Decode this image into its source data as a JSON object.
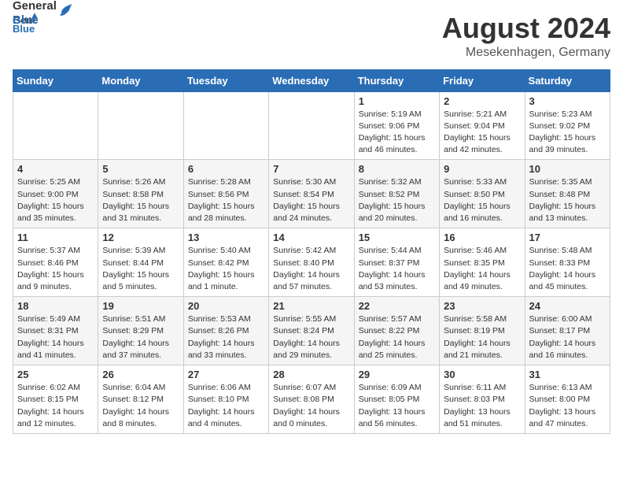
{
  "header": {
    "logo_general": "General",
    "logo_blue": "Blue",
    "month_year": "August 2024",
    "location": "Mesekenhagen, Germany"
  },
  "weekdays": [
    "Sunday",
    "Monday",
    "Tuesday",
    "Wednesday",
    "Thursday",
    "Friday",
    "Saturday"
  ],
  "weeks": [
    [
      {
        "day": "",
        "info": ""
      },
      {
        "day": "",
        "info": ""
      },
      {
        "day": "",
        "info": ""
      },
      {
        "day": "",
        "info": ""
      },
      {
        "day": "1",
        "info": "Sunrise: 5:19 AM\nSunset: 9:06 PM\nDaylight: 15 hours\nand 46 minutes."
      },
      {
        "day": "2",
        "info": "Sunrise: 5:21 AM\nSunset: 9:04 PM\nDaylight: 15 hours\nand 42 minutes."
      },
      {
        "day": "3",
        "info": "Sunrise: 5:23 AM\nSunset: 9:02 PM\nDaylight: 15 hours\nand 39 minutes."
      }
    ],
    [
      {
        "day": "4",
        "info": "Sunrise: 5:25 AM\nSunset: 9:00 PM\nDaylight: 15 hours\nand 35 minutes."
      },
      {
        "day": "5",
        "info": "Sunrise: 5:26 AM\nSunset: 8:58 PM\nDaylight: 15 hours\nand 31 minutes."
      },
      {
        "day": "6",
        "info": "Sunrise: 5:28 AM\nSunset: 8:56 PM\nDaylight: 15 hours\nand 28 minutes."
      },
      {
        "day": "7",
        "info": "Sunrise: 5:30 AM\nSunset: 8:54 PM\nDaylight: 15 hours\nand 24 minutes."
      },
      {
        "day": "8",
        "info": "Sunrise: 5:32 AM\nSunset: 8:52 PM\nDaylight: 15 hours\nand 20 minutes."
      },
      {
        "day": "9",
        "info": "Sunrise: 5:33 AM\nSunset: 8:50 PM\nDaylight: 15 hours\nand 16 minutes."
      },
      {
        "day": "10",
        "info": "Sunrise: 5:35 AM\nSunset: 8:48 PM\nDaylight: 15 hours\nand 13 minutes."
      }
    ],
    [
      {
        "day": "11",
        "info": "Sunrise: 5:37 AM\nSunset: 8:46 PM\nDaylight: 15 hours\nand 9 minutes."
      },
      {
        "day": "12",
        "info": "Sunrise: 5:39 AM\nSunset: 8:44 PM\nDaylight: 15 hours\nand 5 minutes."
      },
      {
        "day": "13",
        "info": "Sunrise: 5:40 AM\nSunset: 8:42 PM\nDaylight: 15 hours\nand 1 minute."
      },
      {
        "day": "14",
        "info": "Sunrise: 5:42 AM\nSunset: 8:40 PM\nDaylight: 14 hours\nand 57 minutes."
      },
      {
        "day": "15",
        "info": "Sunrise: 5:44 AM\nSunset: 8:37 PM\nDaylight: 14 hours\nand 53 minutes."
      },
      {
        "day": "16",
        "info": "Sunrise: 5:46 AM\nSunset: 8:35 PM\nDaylight: 14 hours\nand 49 minutes."
      },
      {
        "day": "17",
        "info": "Sunrise: 5:48 AM\nSunset: 8:33 PM\nDaylight: 14 hours\nand 45 minutes."
      }
    ],
    [
      {
        "day": "18",
        "info": "Sunrise: 5:49 AM\nSunset: 8:31 PM\nDaylight: 14 hours\nand 41 minutes."
      },
      {
        "day": "19",
        "info": "Sunrise: 5:51 AM\nSunset: 8:29 PM\nDaylight: 14 hours\nand 37 minutes."
      },
      {
        "day": "20",
        "info": "Sunrise: 5:53 AM\nSunset: 8:26 PM\nDaylight: 14 hours\nand 33 minutes."
      },
      {
        "day": "21",
        "info": "Sunrise: 5:55 AM\nSunset: 8:24 PM\nDaylight: 14 hours\nand 29 minutes."
      },
      {
        "day": "22",
        "info": "Sunrise: 5:57 AM\nSunset: 8:22 PM\nDaylight: 14 hours\nand 25 minutes."
      },
      {
        "day": "23",
        "info": "Sunrise: 5:58 AM\nSunset: 8:19 PM\nDaylight: 14 hours\nand 21 minutes."
      },
      {
        "day": "24",
        "info": "Sunrise: 6:00 AM\nSunset: 8:17 PM\nDaylight: 14 hours\nand 16 minutes."
      }
    ],
    [
      {
        "day": "25",
        "info": "Sunrise: 6:02 AM\nSunset: 8:15 PM\nDaylight: 14 hours\nand 12 minutes."
      },
      {
        "day": "26",
        "info": "Sunrise: 6:04 AM\nSunset: 8:12 PM\nDaylight: 14 hours\nand 8 minutes."
      },
      {
        "day": "27",
        "info": "Sunrise: 6:06 AM\nSunset: 8:10 PM\nDaylight: 14 hours\nand 4 minutes."
      },
      {
        "day": "28",
        "info": "Sunrise: 6:07 AM\nSunset: 8:08 PM\nDaylight: 14 hours\nand 0 minutes."
      },
      {
        "day": "29",
        "info": "Sunrise: 6:09 AM\nSunset: 8:05 PM\nDaylight: 13 hours\nand 56 minutes."
      },
      {
        "day": "30",
        "info": "Sunrise: 6:11 AM\nSunset: 8:03 PM\nDaylight: 13 hours\nand 51 minutes."
      },
      {
        "day": "31",
        "info": "Sunrise: 6:13 AM\nSunset: 8:00 PM\nDaylight: 13 hours\nand 47 minutes."
      }
    ]
  ]
}
